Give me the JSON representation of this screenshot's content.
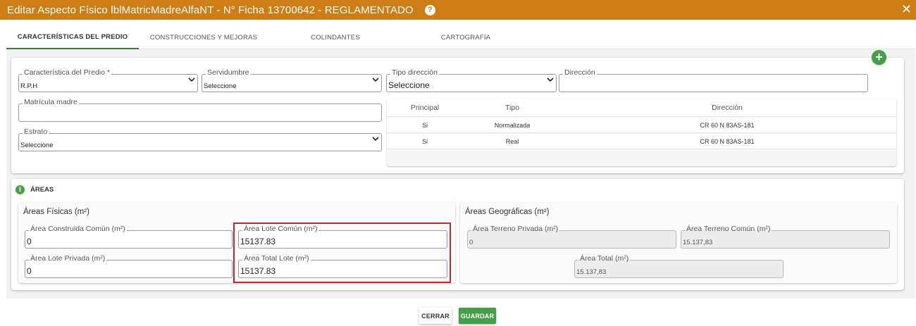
{
  "header": {
    "title": "Editar Aspecto Físico lblMatricMadreAlfaNT - N° Ficha 13700642 - REGLAMENTADO",
    "help_glyph": "?",
    "close_glyph": "✕"
  },
  "tabs": [
    {
      "label": "CARACTERÍSTICAS DEL PREDIO",
      "active": true
    },
    {
      "label": "CONSTRUCCIONES Y MEJORAS",
      "active": false
    },
    {
      "label": "COLINDANTES",
      "active": false
    },
    {
      "label": "CARTOGRAFÍA",
      "active": false
    }
  ],
  "predio": {
    "caracteristica": {
      "label": "Característica del Predio",
      "required_mark": "*",
      "value": "R.P.H"
    },
    "servidumbre": {
      "label": "Servidumbre",
      "value": "Seleccione"
    },
    "tipo_direccion": {
      "label": "Tipo dirección",
      "value": "Seleccione"
    },
    "direccion": {
      "label": "Dirección",
      "value": ""
    },
    "matricula_madre": {
      "label": "Matrícula madre",
      "value": ""
    },
    "estrato": {
      "label": "Estrato",
      "value": "Seleccione"
    },
    "add_glyph": "+"
  },
  "direcciones_table": {
    "columns": [
      "Principal",
      "Tipo",
      "Dirección"
    ],
    "rows": [
      [
        "Si",
        "Normalizada",
        "CR 60 N 83AS-181"
      ],
      [
        "Si",
        "Real",
        "CR 60 N 83AS-181"
      ]
    ]
  },
  "areas": {
    "section_title": "ÁREAS",
    "info_glyph": "i",
    "fisicas": {
      "title": "Áreas Físicas (m²)",
      "construida_comun": {
        "label": "Área Construida Común (m²)",
        "value": "0"
      },
      "lote_comun": {
        "label": "Área Lote Común (m²)",
        "value": "15137.83"
      },
      "lote_privada": {
        "label": "Área Lote Privada (m²)",
        "value": "0"
      },
      "total_lote": {
        "label": "Área Total Lote (m²)",
        "value": "15137.83"
      }
    },
    "geograficas": {
      "title": "Áreas Geográficas (m²)",
      "terreno_privada": {
        "label": "Área Terreno Privada (m²)",
        "value": "0"
      },
      "terreno_comun": {
        "label": "Área Terreno Común (m²)",
        "value": "15.137,83"
      },
      "total": {
        "label": "Área Total (m²)",
        "value": "15.137,83"
      }
    }
  },
  "footer": {
    "cerrar_label": "CERRAR",
    "guardar_label": "GUARDAR"
  },
  "colors": {
    "header_bg": "#cd7d14",
    "primary_green": "#43a047",
    "highlight_red": "#c3282a"
  }
}
